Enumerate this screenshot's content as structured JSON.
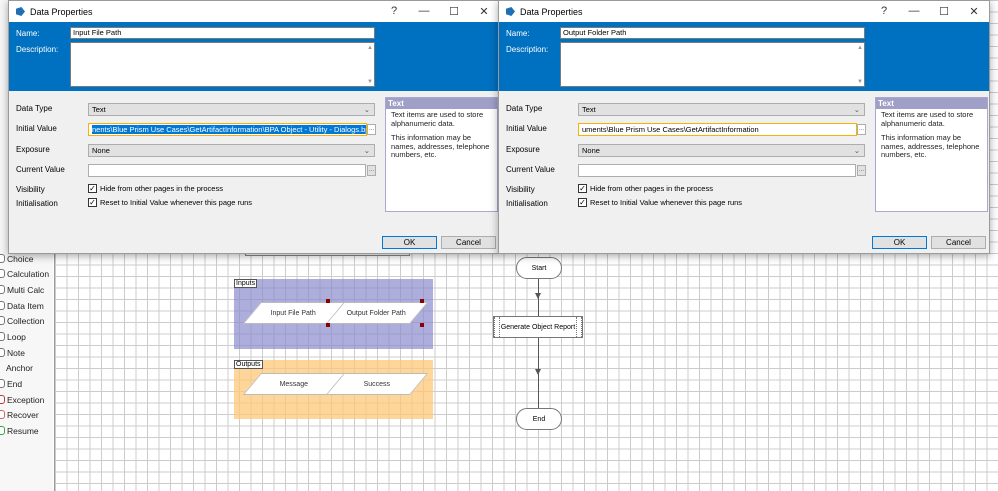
{
  "dialogs": [
    {
      "title": "Data Properties",
      "help": "?",
      "minimize": "—",
      "maximize": "☐",
      "close": "✕",
      "name_label": "Name:",
      "name_value": "Input File Path",
      "description_label": "Description:",
      "data_type_label": "Data Type",
      "data_type_value": "Text",
      "initial_value_label": "Initial Value",
      "initial_value": "nents\\Blue Prism Use Cases\\GetArtifactInformation\\BPA Object - Utility - Dialogs.bpobject",
      "exposure_label": "Exposure",
      "exposure_value": "None",
      "current_value_label": "Current Value",
      "current_value": "",
      "visibility_label": "Visibility",
      "visibility_option": "Hide from other pages in the process",
      "initialisation_label": "Initialisation",
      "initialisation_option": "Reset to Initial Value whenever this page runs",
      "info_title": "Text",
      "info_p1": "Text items are used to store alphanumeric data.",
      "info_p2": "This information may be names, addresses, telephone numbers, etc.",
      "ok": "OK",
      "cancel": "Cancel",
      "browse": "..."
    },
    {
      "title": "Data Properties",
      "help": "?",
      "minimize": "—",
      "maximize": "☐",
      "close": "✕",
      "name_label": "Name:",
      "name_value": "Output Folder Path",
      "description_label": "Description:",
      "data_type_label": "Data Type",
      "data_type_value": "Text",
      "initial_value_label": "Initial Value",
      "initial_value": "uments\\Blue Prism Use Cases\\GetArtifactInformation",
      "exposure_label": "Exposure",
      "exposure_value": "None",
      "current_value_label": "Current Value",
      "current_value": "",
      "visibility_label": "Visibility",
      "visibility_option": "Hide from other pages in the process",
      "initialisation_label": "Initialisation",
      "initialisation_option": "Reset to Initial Value whenever this page runs",
      "info_title": "Text",
      "info_p1": "Text items are used to store alphanumeric data.",
      "info_p2": "This information may be names, addresses, telephone numbers, etc.",
      "ok": "OK",
      "cancel": "Cancel",
      "browse": "..."
    }
  ],
  "sidebar": {
    "items": [
      "Choice",
      "Calculation",
      "Multi Calc",
      "Data Item",
      "Collection",
      "Loop",
      "Note",
      "Anchor",
      "End",
      "Exception",
      "Recover",
      "Resume"
    ]
  },
  "canvas": {
    "inputs_label": "Inputs",
    "inputs": [
      "Input File Path",
      "Output Folder Path"
    ],
    "outputs_label": "Outputs",
    "outputs": [
      "Message",
      "Success"
    ],
    "flow": {
      "start": "Start",
      "action": "Generate Object Report",
      "end": "End"
    }
  },
  "colors": {
    "dialog_blue": "#0070c0",
    "inputs_block": "#a9a9d6",
    "outputs_block": "#fdd59a",
    "focus": "#f5b400"
  }
}
